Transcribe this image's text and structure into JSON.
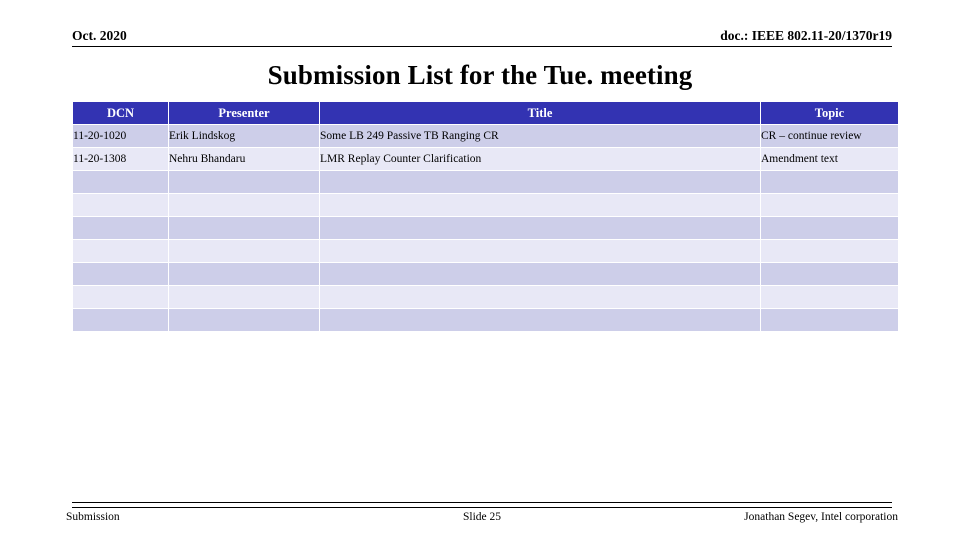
{
  "header": {
    "date": "Oct. 2020",
    "doc_id": "doc.: IEEE 802.11-20/1370r19"
  },
  "title": "Submission List for the Tue. meeting",
  "table": {
    "columns": [
      "DCN",
      "Presenter",
      "Title",
      "Topic"
    ],
    "header_bg": "#3333b2",
    "header_fg": "#ffffff",
    "row_dark_bg": "#cdcee9",
    "row_light_bg": "#e8e8f6",
    "rows": [
      {
        "dcn": "11-20-1020",
        "presenter": "Erik Lindskog",
        "title": "Some LB 249 Passive TB Ranging CR",
        "topic": "CR – continue review"
      },
      {
        "dcn": "11-20-1308",
        "presenter": "Nehru Bhandaru",
        "title": "LMR Replay Counter Clarification",
        "topic": "Amendment text"
      },
      {
        "dcn": "",
        "presenter": "",
        "title": "",
        "topic": ""
      },
      {
        "dcn": "",
        "presenter": "",
        "title": "",
        "topic": ""
      },
      {
        "dcn": "",
        "presenter": "",
        "title": "",
        "topic": ""
      },
      {
        "dcn": "",
        "presenter": "",
        "title": "",
        "topic": ""
      },
      {
        "dcn": "",
        "presenter": "",
        "title": "",
        "topic": ""
      },
      {
        "dcn": "",
        "presenter": "",
        "title": "",
        "topic": ""
      },
      {
        "dcn": "",
        "presenter": "",
        "title": "",
        "topic": ""
      }
    ]
  },
  "footer": {
    "left": "Submission",
    "center": "Slide 25",
    "right": "Jonathan Segev, Intel corporation"
  }
}
